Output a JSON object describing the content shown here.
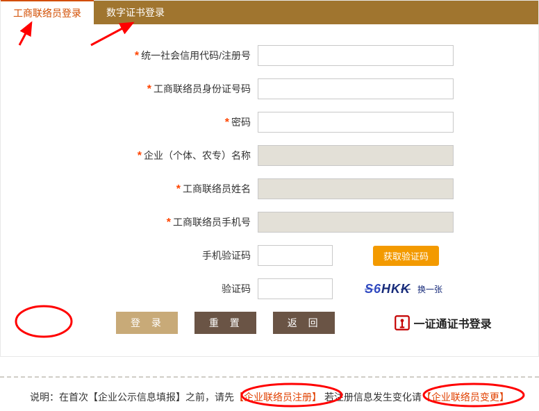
{
  "tabs": {
    "liaison": "工商联络员登录",
    "cert": "数字证书登录"
  },
  "labels": {
    "credit": "统一社会信用代码/注册号",
    "id": "工商联络员身份证号码",
    "password": "密码",
    "company": "企业（个体、农专）名称",
    "name": "工商联络员姓名",
    "mobile": "工商联络员手机号",
    "smscode": "手机验证码",
    "captcha": "验证码"
  },
  "buttons": {
    "getcode": "获取验证码",
    "login": "登 录",
    "reset": "重 置",
    "back": "返 回",
    "certlogin": "一证通证书登录",
    "change": "换一张"
  },
  "captcha_text": "S6HKK",
  "footer": {
    "prefix": "说明：在首次【企业公示信息填报】之前，请先",
    "link1_open": "【",
    "link1": "企业联络员注册",
    "link1_close": "】",
    "mid": "若注册信息发生变化请",
    "link2_open": "【",
    "link2": "企业联络员变更",
    "link2_close": "】"
  }
}
